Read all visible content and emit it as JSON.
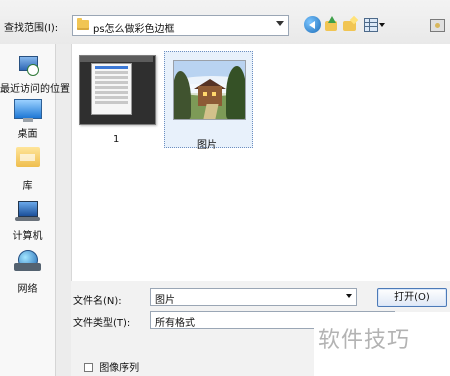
{
  "topbar": {
    "look_in_label": "查找范围(I):",
    "location_value": "ps怎么做彩色边框",
    "icons": {
      "back": "back-icon",
      "up": "up-folder-icon",
      "new_folder": "new-folder-icon",
      "view": "view-menu-icon",
      "desktop": "desktop-icon"
    }
  },
  "sidebar": {
    "items": [
      {
        "label": "最近访问的位置",
        "icon": "recent-places-icon"
      },
      {
        "label": "桌面",
        "icon": "desktop-icon"
      },
      {
        "label": "库",
        "icon": "library-icon"
      },
      {
        "label": "计算机",
        "icon": "computer-icon"
      },
      {
        "label": "网络",
        "icon": "network-icon"
      }
    ]
  },
  "content": {
    "files": [
      {
        "label": "1",
        "icon": "screenshot-thumbnail"
      },
      {
        "label": "图片",
        "icon": "landscape-thumbnail"
      }
    ]
  },
  "bottom": {
    "file_name_label": "文件名(N):",
    "file_name_value": "图片",
    "file_type_label": "文件类型(T):",
    "file_type_value": "所有格式",
    "open_button": "打开(O)",
    "sequence_label": "图像序列"
  },
  "watermark": {
    "text": "软件技巧"
  }
}
